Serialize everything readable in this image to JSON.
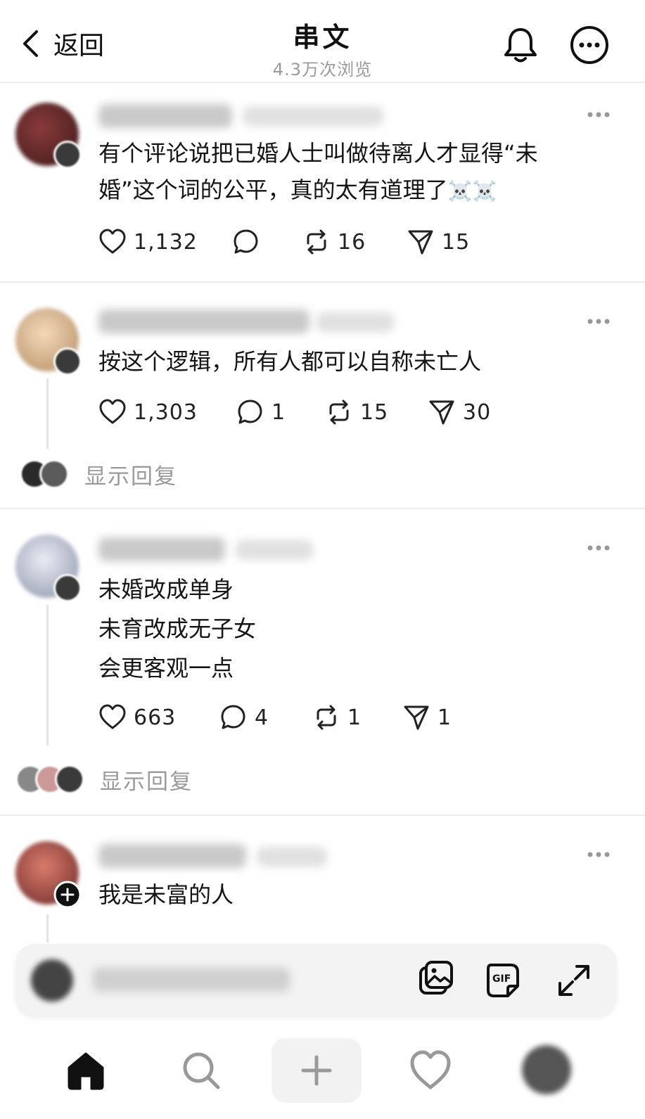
{
  "header": {
    "back_label": "返回",
    "title": "串文",
    "views": "4.3万次浏览"
  },
  "posts": [
    {
      "text_lines": [
        "有个评论说把已婚人士叫做待离人才显得“未",
        "婚”这个词的公平，真的太有道理了"
      ],
      "emoji": "☠️☠️",
      "likes": "1,132",
      "comments": "",
      "reposts": "16",
      "shares": "15"
    },
    {
      "text_lines": [
        "按这个逻辑，所有人都可以自称未亡人"
      ],
      "likes": "1,303",
      "comments": "1",
      "reposts": "15",
      "shares": "30",
      "replies_label": "显示回复"
    },
    {
      "text_lines": [
        "未婚改成单身",
        "未育改成无子女",
        "会更客观一点"
      ],
      "likes": "663",
      "comments": "4",
      "reposts": "1",
      "shares": "1",
      "replies_label": "显示回复"
    },
    {
      "text_lines": [
        "我是未富的人"
      ]
    }
  ],
  "icons": {
    "back": "chevron-left-icon",
    "bell": "bell-icon",
    "more": "more-circle-icon",
    "like": "heart-icon",
    "comment": "comment-icon",
    "repost": "repost-icon",
    "share": "send-icon",
    "image": "image-icon",
    "gif": "gif-icon",
    "expand": "expand-icon",
    "home": "home-icon",
    "search": "search-icon",
    "add": "plus-icon",
    "activity": "heart-icon",
    "follow": "plus-circle-icon"
  },
  "colors": {
    "text": "#151515",
    "muted": "#9a9a9a",
    "divider": "#ececec"
  }
}
